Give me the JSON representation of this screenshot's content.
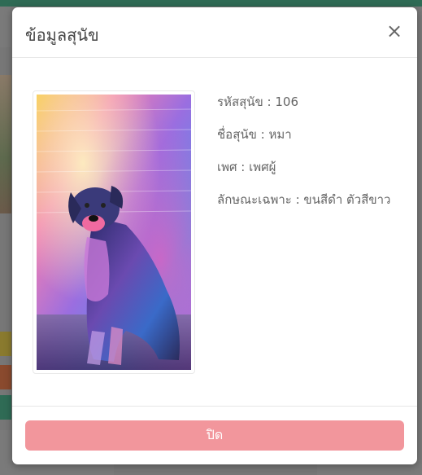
{
  "modal": {
    "title": "ข้อมูลสุนัข",
    "close_icon": "close-icon",
    "close_symbol": "×",
    "photo_alt": "dog-photo",
    "fields": [
      {
        "label": "รหัสสุนัข",
        "value": "106",
        "text": "รหัสสุนัข : 106"
      },
      {
        "label": "ชื่อสุนัข",
        "value": "หมา",
        "text": "ชื่อสุนัข : หมา"
      },
      {
        "label": "เพศ",
        "value": "เพศผู้",
        "text": "เพศ : เพศผู้"
      },
      {
        "label": "ลักษณะเฉพาะ",
        "value": "ขนสีดำ ตัวสีขาว",
        "text": "ลักษณะเฉพาะ : ขนสีดำ ตัวสีขาว"
      }
    ],
    "footer_button": "ปิด"
  },
  "colors": {
    "close_button_bg": "#f2969c",
    "title_text": "#444444",
    "info_text": "#666666"
  }
}
